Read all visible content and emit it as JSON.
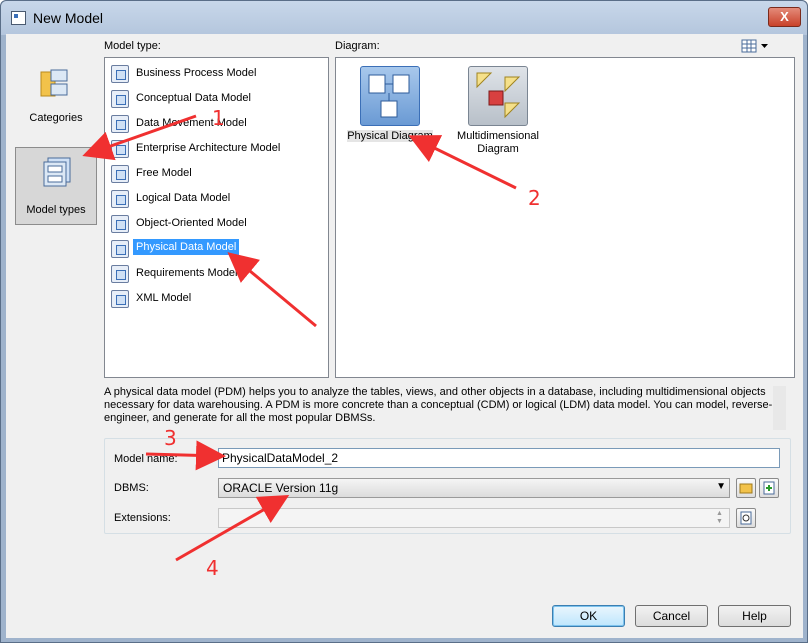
{
  "window": {
    "title": "New Model",
    "close_label": "X"
  },
  "left_panel": {
    "items": [
      {
        "label": "Categories",
        "icon": "folder-icon",
        "selected": false
      },
      {
        "label": "Model types",
        "icon": "model-types-icon",
        "selected": true
      }
    ]
  },
  "model_type": {
    "label": "Model type:",
    "items": [
      {
        "label": "Business Process Model"
      },
      {
        "label": "Conceptual Data Model"
      },
      {
        "label": "Data Movement Model"
      },
      {
        "label": "Enterprise Architecture Model"
      },
      {
        "label": "Free Model"
      },
      {
        "label": "Logical Data Model"
      },
      {
        "label": "Object-Oriented Model"
      },
      {
        "label": "Physical Data Model",
        "selected": true
      },
      {
        "label": "Requirements Model"
      },
      {
        "label": "XML Model"
      }
    ]
  },
  "diagram": {
    "label": "Diagram:",
    "items": [
      {
        "label": "Physical Diagram",
        "selected": true
      },
      {
        "label": "Multidimensional Diagram",
        "selected": false
      }
    ]
  },
  "description": "A physical data model (PDM) helps you to analyze the tables, views, and other objects in a database, including multidimensional objects necessary for data warehousing. A PDM is more concrete than a conceptual (CDM) or logical (LDM) data model. You can model, reverse-engineer, and generate for all the most popular DBMSs.",
  "form": {
    "model_name_label": "Model name:",
    "model_name_value": "PhysicalDataModel_2",
    "dbms_label": "DBMS:",
    "dbms_value": "ORACLE Version 11g",
    "extensions_label": "Extensions:",
    "extensions_value": ""
  },
  "buttons": {
    "ok": "OK",
    "cancel": "Cancel",
    "help": "Help"
  },
  "annotations": [
    "1",
    "2",
    "3",
    "4"
  ],
  "colors": {
    "annotation": "#f03030",
    "selection": "#3399ff"
  }
}
